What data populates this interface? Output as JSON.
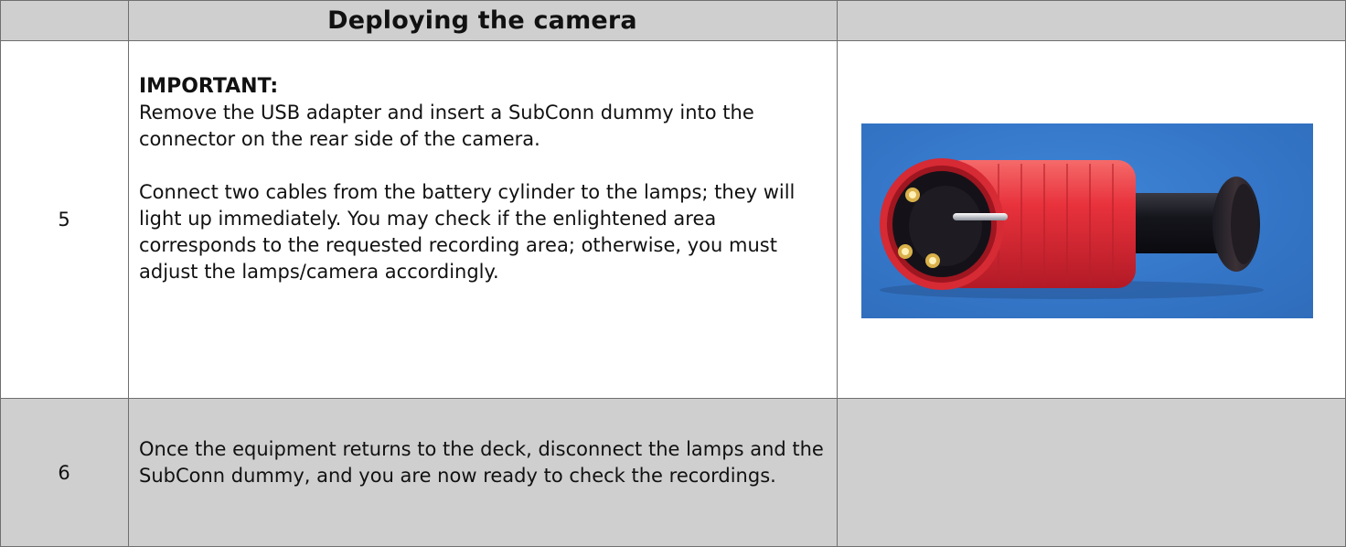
{
  "header": {
    "title": "Deploying the camera"
  },
  "rows": [
    {
      "number": "5",
      "heading": "IMPORTANT:",
      "paragraph1": "Remove the USB adapter and insert a SubConn dummy into the connector on the rear side of the camera.",
      "paragraph2": "Connect two cables from the battery cylinder to the lamps; they will light up immediately. You may check if the enlightened area corresponds to the requested recording area; otherwise, you must adjust the lamps/camera accordingly."
    },
    {
      "number": "6",
      "paragraph1": "Once the equipment returns to the deck, disconnect the lamps and the SubConn dummy, and you are now ready to check the recordings."
    }
  ],
  "colors": {
    "header_fill": "#cfcfcf",
    "row6_fill": "#cfcfcf",
    "photo_background": "#3a7dd0",
    "connector_red": "#e8323c"
  }
}
